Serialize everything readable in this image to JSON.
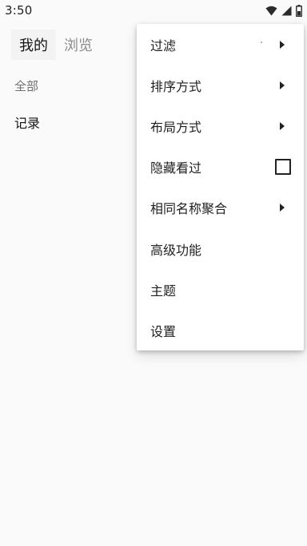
{
  "status_bar": {
    "time": "3:50",
    "icons": [
      "wifi-icon",
      "cellular-signal-icon",
      "battery-icon"
    ]
  },
  "tabs": [
    {
      "label": "我的",
      "active": true
    },
    {
      "label": "浏览",
      "active": false
    }
  ],
  "main": {
    "section_label": "全部",
    "list_items": [
      "记录"
    ]
  },
  "menu": {
    "items": [
      {
        "label": "过滤",
        "trailing": "submenu-arrow-icon"
      },
      {
        "label": "排序方式",
        "trailing": "submenu-arrow-icon"
      },
      {
        "label": "布局方式",
        "trailing": "submenu-arrow-icon"
      },
      {
        "label": "隐藏看过",
        "trailing": "checkbox",
        "checked": false
      },
      {
        "label": "相同名称聚合",
        "trailing": "submenu-arrow-icon"
      },
      {
        "label": "高级功能",
        "trailing": ""
      },
      {
        "label": "主题",
        "trailing": ""
      },
      {
        "label": "设置",
        "trailing": ""
      }
    ]
  },
  "colors": {
    "background": "#fafafa",
    "menu_background": "#ffffff",
    "text_primary": "#1f1f1f",
    "text_secondary": "#8a8a8a"
  }
}
